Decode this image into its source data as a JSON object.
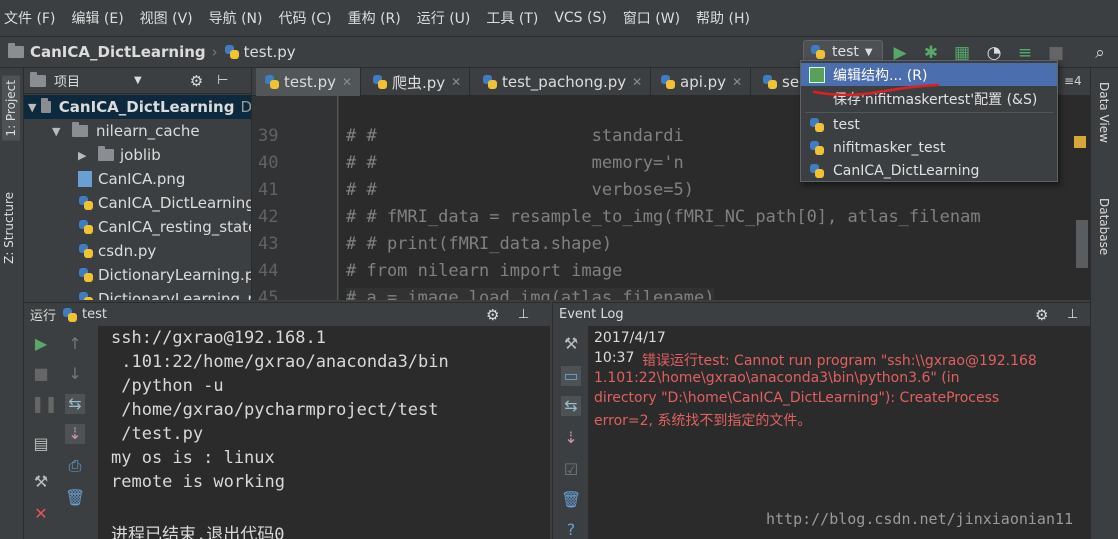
{
  "menu": [
    "文件 (F)",
    "编辑 (E)",
    "视图 (V)",
    "导航 (N)",
    "代码 (C)",
    "重构 (R)",
    "运行 (U)",
    "工具 (T)",
    "VCS (S)",
    "窗口 (W)",
    "帮助 (H)"
  ],
  "breadcrumb": {
    "project": "CanICA_DictLearning",
    "file": "test.py"
  },
  "run_config": {
    "selected": "test"
  },
  "side_tabs": {
    "project": "1: Project",
    "structure": "Z: Structure",
    "data_view": "Data View",
    "database": "Database"
  },
  "project_panel": {
    "title": "项目",
    "root": "CanICA_DictLearning",
    "root_suffix": "D",
    "items": [
      "nilearn_cache",
      "joblib",
      "CanICA.png",
      "CanICA_DictLearning",
      "CanICA_resting_state",
      "csdn.py",
      "DictionaryLearning.p",
      "DictionaryLearning_r"
    ]
  },
  "editor_tabs": [
    "test.py",
    "爬虫.py",
    "test_pachong.py",
    "api.py",
    "se"
  ],
  "editor_tabs_overflow": "≡4",
  "editor": {
    "line_numbers": [
      "39",
      "40",
      "41",
      "42",
      "43",
      "44",
      "45"
    ],
    "lines": [
      "# #                     standardi",
      "# #                     memory='n",
      "# #                     verbose=5)",
      "# # fMRI_data = resample_to_img(fMRI_NC_path[0], atlas_filenam",
      "# # print(fMRI_data.shape)",
      "# from nilearn import image",
      "# a = image.load_img(atlas_filename)"
    ]
  },
  "dropdown": {
    "items": [
      "编辑结构... (R)",
      "保存'nifitmaskertest'配置 (&S)",
      "test",
      "nifitmasker_test",
      "CanICA_DictLearning"
    ]
  },
  "run_panel": {
    "title": "运行",
    "config": "test",
    "console": [
      "ssh://gxrao@192.168.1",
      " .101:22/home/gxrao/anaconda3/bin",
      " /python -u",
      " /home/gxrao/pycharmproject/test",
      " /test.py",
      "my os is : linux",
      "remote is working",
      "",
      "进程已结束,退出代码0"
    ]
  },
  "event_log": {
    "title": "Event Log",
    "date": "2017/4/17",
    "time": "10:37",
    "message_lines": [
      "错误运行test: Cannot run program \"ssh:\\\\gxrao@192.168",
      "1.101:22\\home\\gxrao\\anaconda3\\bin\\python3.6\" (in",
      "directory \"D:\\home\\CanICA_DictLearning\"): CreateProcess",
      "error=2, 系统找不到指定的文件。"
    ]
  },
  "watermark": "http://blog.csdn.net/jinxiaonian11",
  "colors": {
    "accent": "#4b6eaf",
    "error": "#e06060",
    "run_green": "#59a869",
    "close_red": "#e05555",
    "annotation_red": "#e02020"
  }
}
